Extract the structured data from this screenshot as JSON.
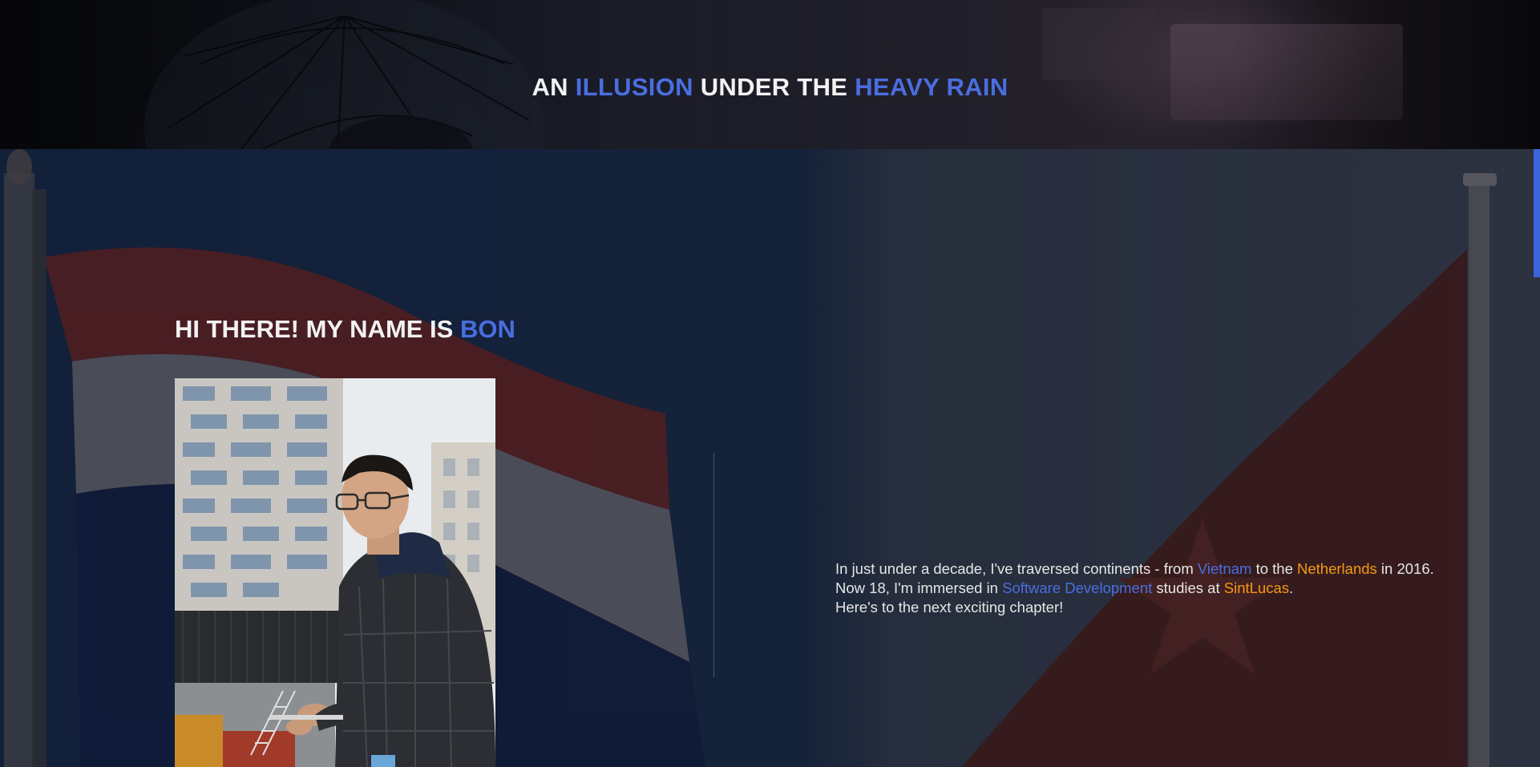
{
  "header": {
    "title_parts": [
      "AN ",
      "ILLUSION",
      " UNDER THE ",
      "HEAVY RAIN"
    ]
  },
  "intro": {
    "heading_prefix": "HI THERE! MY NAME IS ",
    "heading_name": "BON"
  },
  "portrait": {
    "alt": "Bon"
  },
  "bio": {
    "line1": {
      "a": "In just under a decade, I've traversed continents - from ",
      "vietnam": "Vietnam",
      "b": " to the ",
      "netherlands": "Netherlands",
      "c": " in 2016."
    },
    "line2": {
      "a": "Now 18, I'm immersed in ",
      "software": "Software Development",
      "b": " studies at ",
      "school": "SintLucas",
      "c": "."
    },
    "line3": "Here's to the next exciting chapter!"
  },
  "colors": {
    "accent": "#4a6ee0",
    "highlight": "#f39a12",
    "text": "#f2f2f2",
    "background": "#12203a"
  },
  "icons": {
    "scrollbar": "scrollbar-thumb"
  }
}
